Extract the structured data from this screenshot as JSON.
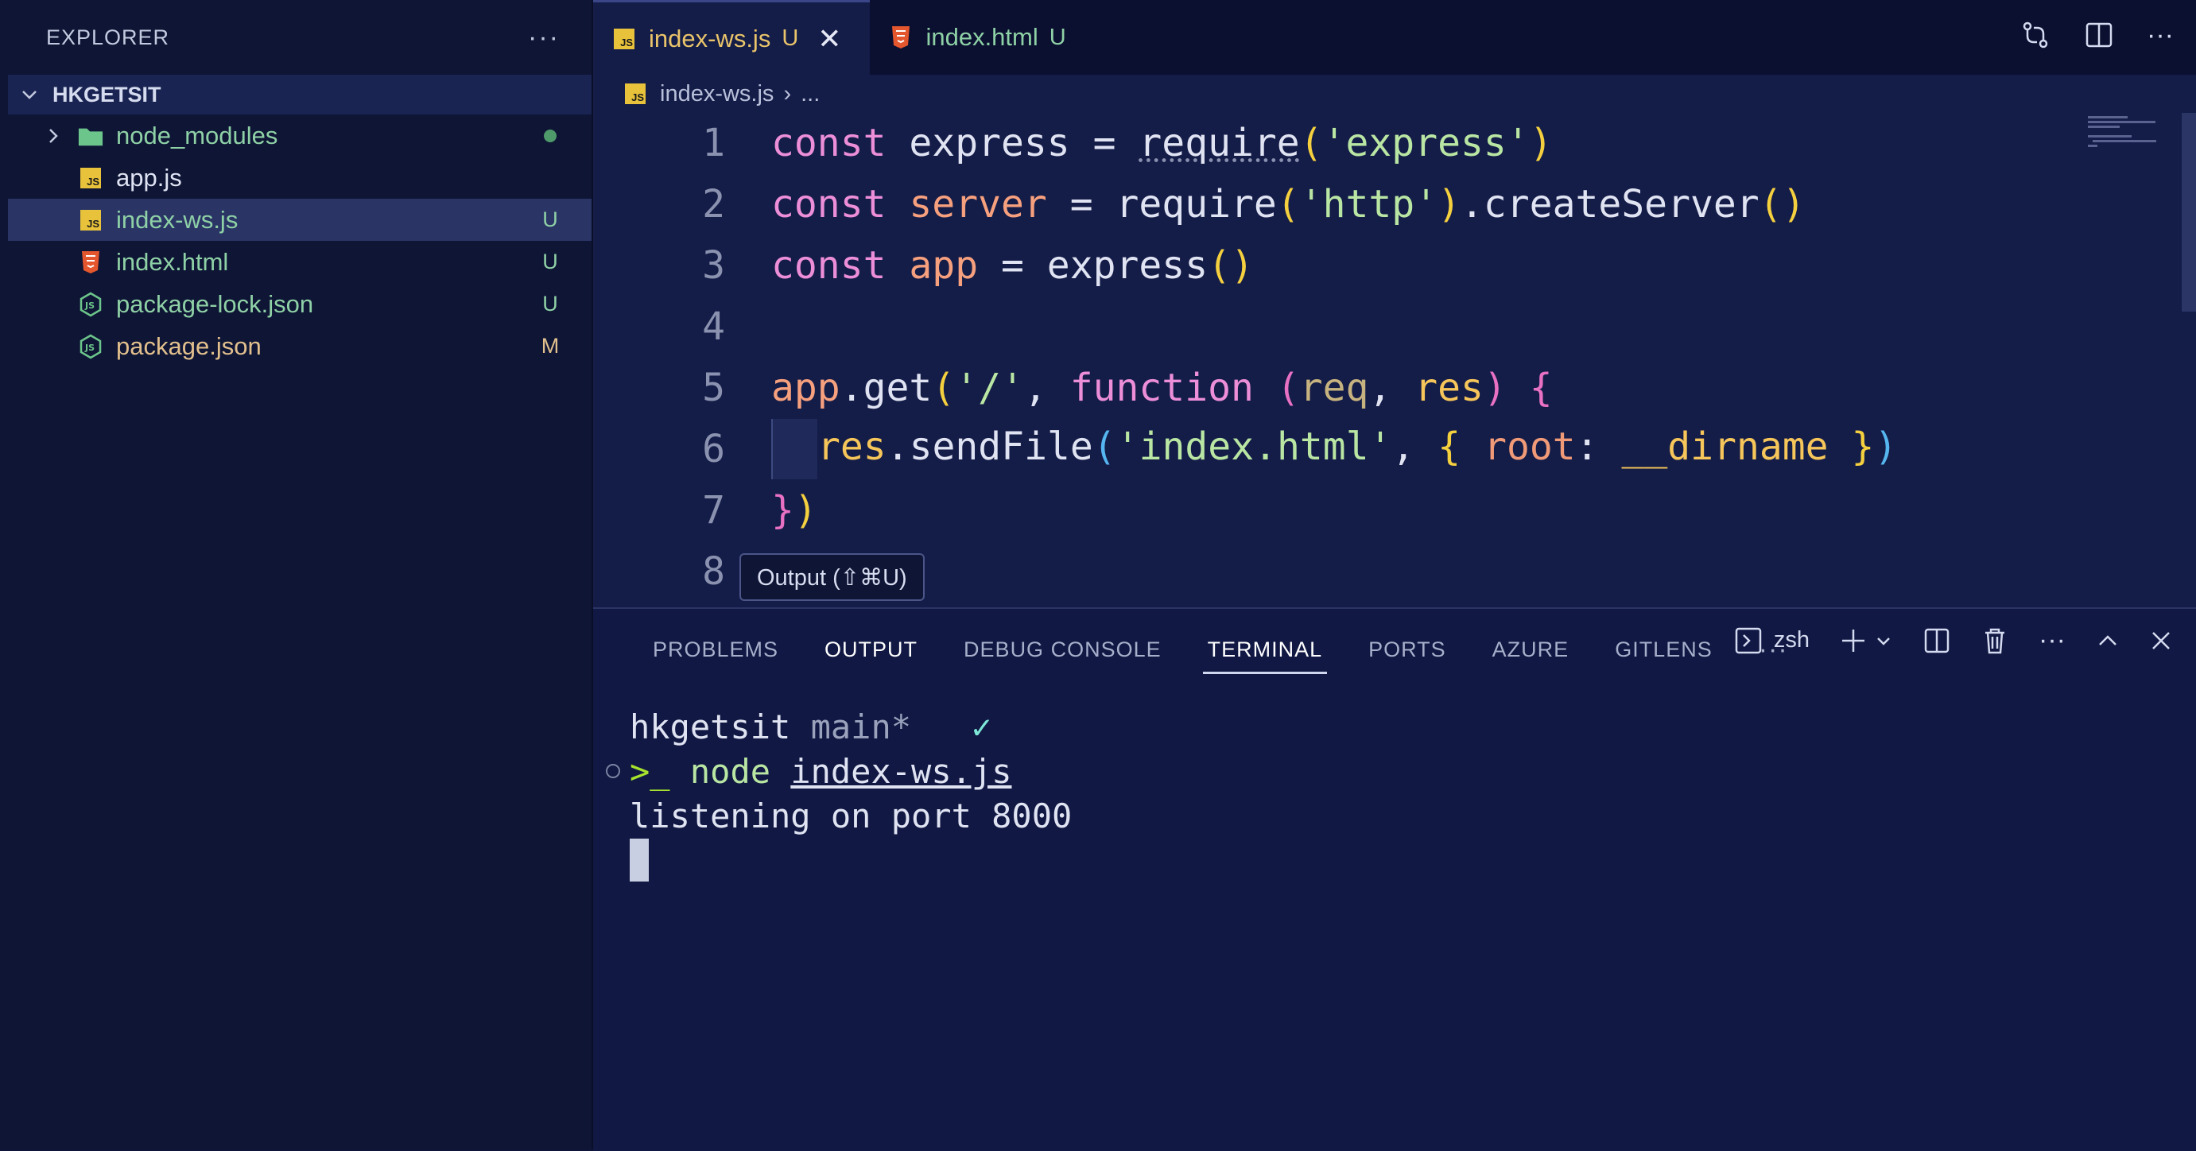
{
  "sidebar": {
    "title": "EXPLORER",
    "more": "···",
    "root": "HKGETSIT",
    "items": [
      {
        "name": "node_modules",
        "status": "",
        "color": "#8fd1a6",
        "type": "folder"
      },
      {
        "name": "app.js",
        "status": "",
        "color": "#dfe3f2",
        "type": "js"
      },
      {
        "name": "index-ws.js",
        "status": "U",
        "color": "#8fd1a6",
        "type": "js"
      },
      {
        "name": "index.html",
        "status": "U",
        "color": "#8fd1a6",
        "type": "html"
      },
      {
        "name": "package-lock.json",
        "status": "U",
        "color": "#8fd1a6",
        "type": "json"
      },
      {
        "name": "package.json",
        "status": "M",
        "color": "#e2c08d",
        "type": "json"
      }
    ]
  },
  "tabs": [
    {
      "label": "index-ws.js",
      "status": "U",
      "active": true
    },
    {
      "label": "index.html",
      "status": "U",
      "active": false
    }
  ],
  "breadcrumb": {
    "file": "index-ws.js",
    "rest": "..."
  },
  "editor": {
    "line_numbers": [
      "1",
      "2",
      "3",
      "4",
      "5",
      "6",
      "7",
      "8"
    ]
  },
  "tooltip": "Output (⇧⌘U)",
  "panel": {
    "tabs": [
      "PROBLEMS",
      "OUTPUT",
      "DEBUG CONSOLE",
      "TERMINAL",
      "PORTS",
      "AZURE",
      "GITLENS"
    ],
    "more": "···",
    "shell": "zsh",
    "terminal": {
      "host": "hkgetsit",
      "branch": "main*",
      "check": "✓",
      "prompt": ">_",
      "cmd": "node",
      "arg": "index-ws.js",
      "output": "listening on port 8000"
    }
  }
}
